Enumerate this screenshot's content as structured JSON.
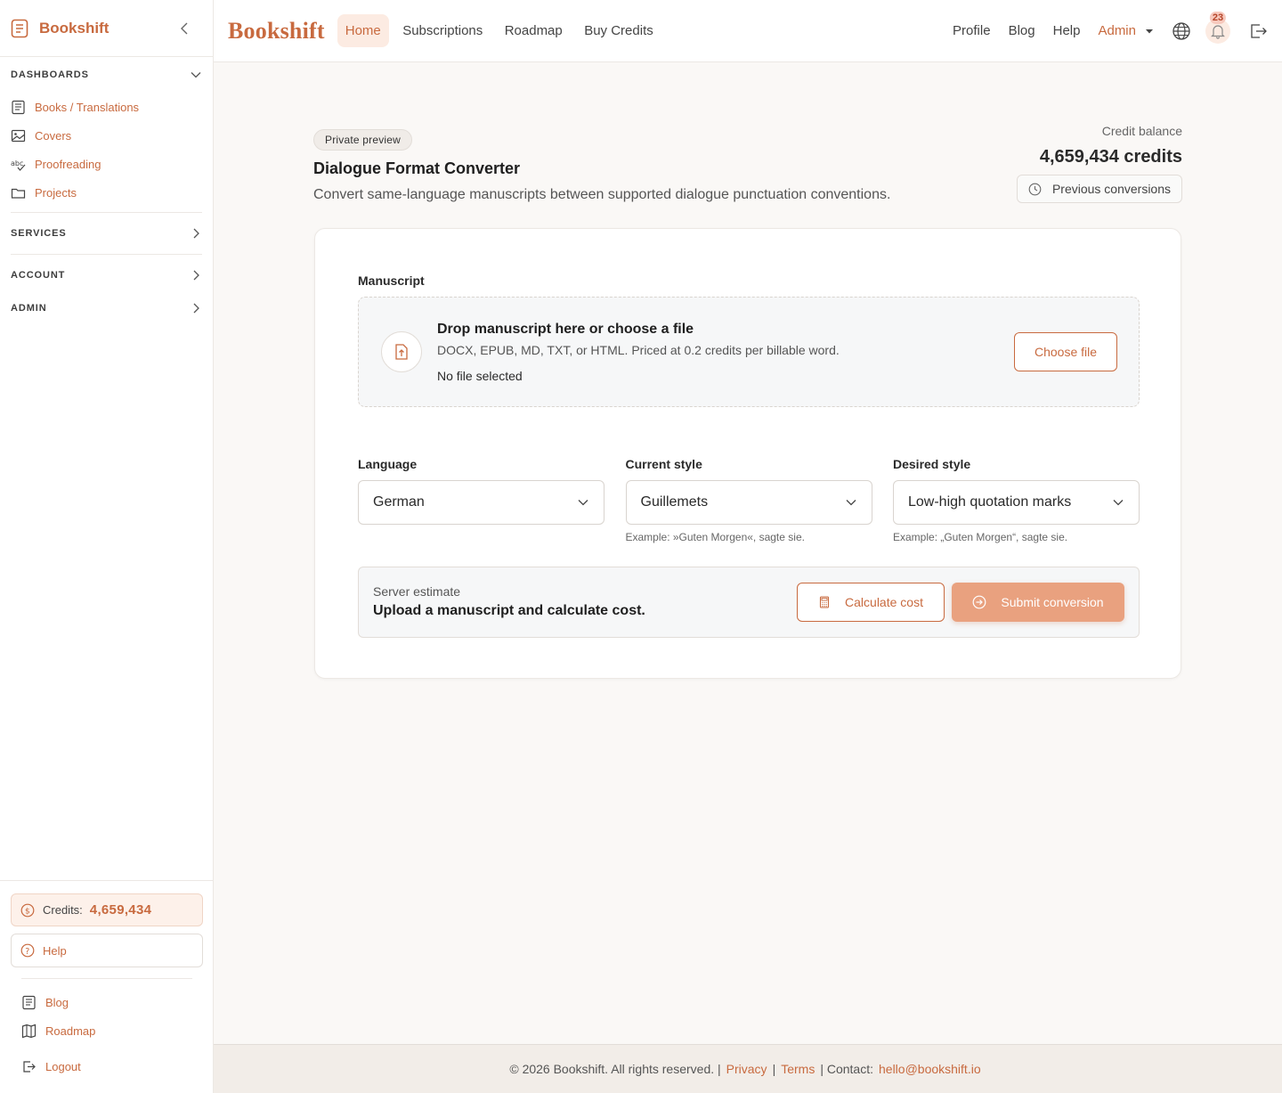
{
  "sidebar": {
    "brand": "Bookshift",
    "sections": {
      "dashboards": "DASHBOARDS",
      "services": "SERVICES",
      "account": "ACCOUNT",
      "admin": "ADMIN"
    },
    "items": [
      {
        "label": "Books / Translations",
        "icon": "book-list-icon"
      },
      {
        "label": "Covers",
        "icon": "image-icon"
      },
      {
        "label": "Proofreading",
        "icon": "spellcheck-icon"
      },
      {
        "label": "Projects",
        "icon": "folder-icon"
      }
    ],
    "credits_label": "Credits:",
    "credits_value": "4,659,434",
    "help_label": "Help",
    "links": [
      {
        "label": "Blog",
        "icon": "blog-icon"
      },
      {
        "label": "Roadmap",
        "icon": "map-icon"
      },
      {
        "label": "Logout",
        "icon": "logout-icon"
      }
    ]
  },
  "header": {
    "wordmark": "Bookshift",
    "nav": [
      "Home",
      "Subscriptions",
      "Roadmap",
      "Buy Credits"
    ],
    "active_nav": "Home",
    "right_nav": [
      "Profile",
      "Blog",
      "Help"
    ],
    "admin_label": "Admin",
    "notification_count": "23"
  },
  "page": {
    "badge": "Private preview",
    "title": "Dialogue Format Converter",
    "subtitle": "Convert same-language manuscripts between supported dialogue punctuation conventions.",
    "balance_label": "Credit balance",
    "balance_value": "4,659,434 credits",
    "previous_label": "Previous conversions"
  },
  "form": {
    "manuscript_label": "Manuscript",
    "drop_title": "Drop manuscript here or choose a file",
    "drop_formats": "DOCX, EPUB, MD, TXT, or HTML. Priced at 0.2 credits per billable word.",
    "drop_status": "No file selected",
    "choose_file": "Choose file",
    "language_label": "Language",
    "language_value": "German",
    "current_label": "Current style",
    "current_value": "Guillemets",
    "current_example": "Example: »Guten Morgen«, sagte sie.",
    "desired_label": "Desired style",
    "desired_value": "Low-high quotation marks",
    "desired_example": "Example: „Guten Morgen“, sagte sie.",
    "estimate_label": "Server estimate",
    "estimate_text": "Upload a manuscript and calculate cost.",
    "calculate": "Calculate cost",
    "submit": "Submit conversion"
  },
  "footer": {
    "copyright": "© 2026 Bookshift. All rights reserved. |",
    "privacy": "Privacy",
    "sep1": "|",
    "terms": "Terms",
    "contact": "| Contact:",
    "email": "hello@bookshift.io"
  },
  "colors": {
    "accent": "#c86a3f",
    "accent_soft": "#fcebe2",
    "submit_bg": "#e9a17f"
  }
}
